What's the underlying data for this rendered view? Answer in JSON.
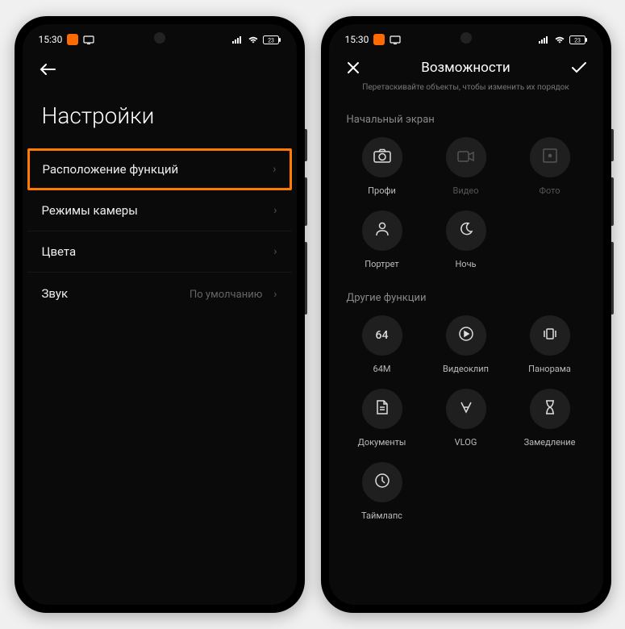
{
  "status": {
    "time": "15:30",
    "battery": "23"
  },
  "left": {
    "title": "Настройки",
    "items": [
      {
        "label": "Расположение функций",
        "value": "",
        "highlighted": true
      },
      {
        "label": "Режимы камеры",
        "value": ""
      },
      {
        "label": "Цвета",
        "value": ""
      },
      {
        "label": "Звук",
        "value": "По умолчанию"
      }
    ]
  },
  "right": {
    "title": "Возможности",
    "subtitle": "Перетаскивайте объекты, чтобы изменить их порядок",
    "section1_label": "Начальный экран",
    "section1_items": [
      {
        "name": "profi",
        "label": "Профи",
        "icon": "camera",
        "dim": false
      },
      {
        "name": "video",
        "label": "Видео",
        "icon": "videocam",
        "dim": true
      },
      {
        "name": "photo",
        "label": "Фото",
        "icon": "dot-square",
        "dim": true
      },
      {
        "name": "portrait",
        "label": "Портрет",
        "icon": "person",
        "dim": false
      },
      {
        "name": "night",
        "label": "Ночь",
        "icon": "moon",
        "dim": false
      }
    ],
    "section2_label": "Другие функции",
    "section2_items": [
      {
        "name": "64m",
        "label": "64М",
        "icon": "text-64",
        "dim": false
      },
      {
        "name": "videoclip",
        "label": "Видеоклип",
        "icon": "play-circle",
        "dim": false
      },
      {
        "name": "panorama",
        "label": "Панорама",
        "icon": "panorama",
        "dim": false
      },
      {
        "name": "documents",
        "label": "Документы",
        "icon": "document",
        "dim": false
      },
      {
        "name": "vlog",
        "label": "VLOG",
        "icon": "vlog",
        "dim": false
      },
      {
        "name": "slowmo",
        "label": "Замедление",
        "icon": "hourglass",
        "dim": false
      },
      {
        "name": "timelapse",
        "label": "Таймлапс",
        "icon": "clock",
        "dim": false
      }
    ]
  }
}
